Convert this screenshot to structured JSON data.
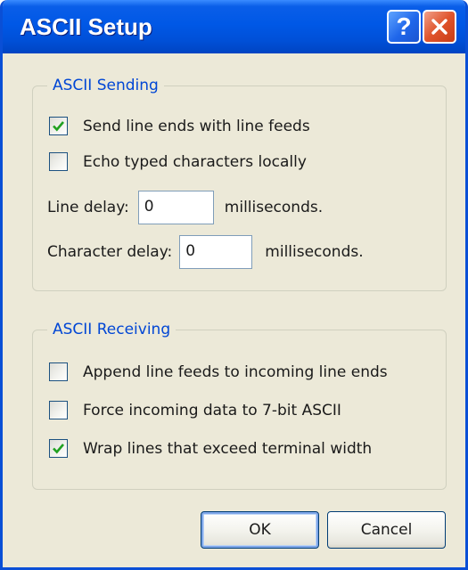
{
  "window": {
    "title": "ASCII Setup",
    "help_glyph": "?",
    "icons": {
      "help": "help-icon",
      "close": "close-icon"
    }
  },
  "sending": {
    "legend": "ASCII Sending",
    "send_line_ends": {
      "label": "Send line ends with line feeds",
      "checked": true
    },
    "echo_typed": {
      "label": "Echo typed characters locally",
      "checked": false
    },
    "line_delay": {
      "label": "Line delay:",
      "value": "0",
      "unit": "milliseconds."
    },
    "character_delay": {
      "label": "Character delay:",
      "value": "0",
      "unit": "milliseconds."
    }
  },
  "receiving": {
    "legend": "ASCII Receiving",
    "append_line_feeds": {
      "label": "Append line feeds to incoming line ends",
      "checked": false
    },
    "force_7bit": {
      "label": "Force incoming data to 7-bit ASCII",
      "checked": false
    },
    "wrap_lines": {
      "label": "Wrap lines that exceed terminal width",
      "checked": true
    }
  },
  "buttons": {
    "ok": "OK",
    "cancel": "Cancel"
  },
  "colors": {
    "titlebar": "#0058e6",
    "dialog_bg": "#ece9d8",
    "group_legend": "#0046d5",
    "checkmark": "#21a121",
    "close_button": "#e0542c"
  }
}
